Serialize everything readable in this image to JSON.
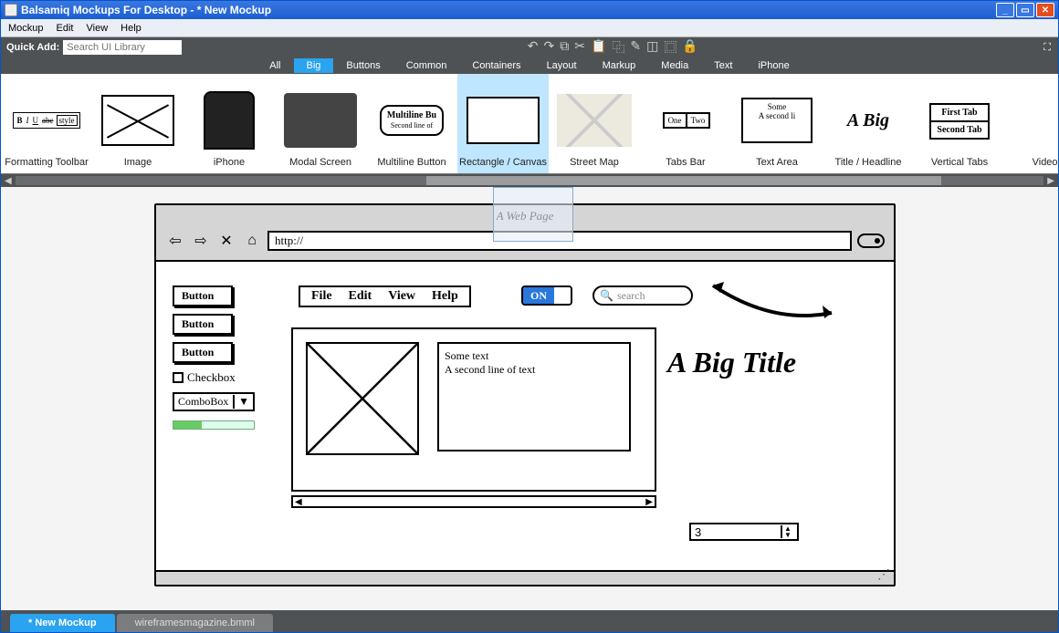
{
  "window": {
    "title": "Balsamiq Mockups For Desktop - * New Mockup"
  },
  "menubar": [
    "Mockup",
    "Edit",
    "View",
    "Help"
  ],
  "quickadd": {
    "label": "Quick Add:",
    "placeholder": "Search UI Library"
  },
  "categories": [
    "All",
    "Big",
    "Buttons",
    "Common",
    "Containers",
    "Layout",
    "Markup",
    "Media",
    "Text",
    "iPhone"
  ],
  "active_category": "Big",
  "library": [
    {
      "label": "Formatting Toolbar"
    },
    {
      "label": "Image"
    },
    {
      "label": "iPhone"
    },
    {
      "label": "Modal Screen"
    },
    {
      "label": "Multiline Button",
      "line1": "Multiline Bu",
      "line2": "Second line of"
    },
    {
      "label": "Rectangle / Canvas",
      "selected": true
    },
    {
      "label": "Street Map"
    },
    {
      "label": "Tabs Bar",
      "t1": "One",
      "t2": "Two"
    },
    {
      "label": "Text Area",
      "line1": "Some",
      "line2": "A second li"
    },
    {
      "label": "Title / Headline",
      "text": "A Big"
    },
    {
      "label": "Vertical Tabs",
      "t1": "First Tab",
      "t2": "Second Tab"
    },
    {
      "label": "Video Pl"
    }
  ],
  "browser": {
    "title": "A Web Page",
    "url": "http://",
    "buttons": [
      "Button",
      "Button",
      "Button"
    ],
    "checkbox": "Checkbox",
    "combo": "ComboBox",
    "menu": [
      "File",
      "Edit",
      "View",
      "Help"
    ],
    "toggle": "ON",
    "search_placeholder": "search",
    "headline": "A Big Title",
    "text1": "Some text",
    "text2": "A second line of text",
    "stepper_value": "3"
  },
  "doctabs": [
    {
      "label": "* New Mockup",
      "active": true
    },
    {
      "label": "wireframesmagazine.bmml",
      "active": false
    }
  ]
}
